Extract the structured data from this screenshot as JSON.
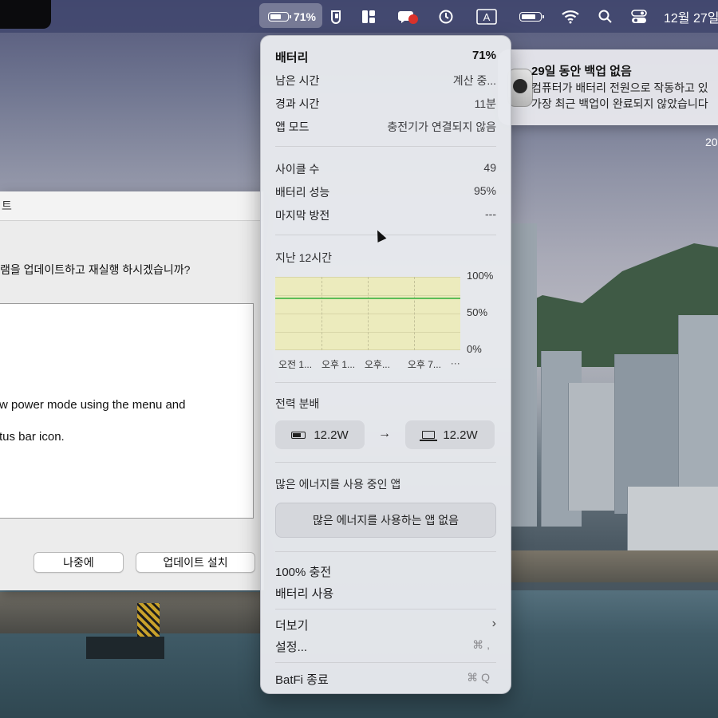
{
  "menubar": {
    "battery_percent": "71%",
    "battery_level": 0.71,
    "clock": "12월 27일"
  },
  "notification": {
    "title": "29일 동안 백업 없음",
    "line1": "컴퓨터가 배터리 전원으로 작동하고 있",
    "line2": "가장 최근 백업이 완료되지 않았습니다"
  },
  "desktop_date": "20",
  "dialog": {
    "title": "트",
    "question": "램을 업데이트하고 재실행 하시겠습니까?",
    "note_line1": "w power mode using the menu and",
    "note_line2": "tus bar icon.",
    "later_button": "나중에",
    "install_button": "업데이트 설치"
  },
  "panel": {
    "title": "배터리",
    "percent": "71%",
    "rows": [
      {
        "label": "남은 시간",
        "value": "계산 중..."
      },
      {
        "label": "경과 시간",
        "value": "11분"
      },
      {
        "label": "앱 모드",
        "value": "충전기가 연결되지 않음"
      }
    ],
    "health": [
      {
        "label": "사이클 수",
        "value": "49"
      },
      {
        "label": "배터리 성능",
        "value": "95%"
      },
      {
        "label": "마지막 방전",
        "value": "---"
      }
    ],
    "history_label": "지난 12시간",
    "power_label": "전력 분배",
    "power_in": "12.2W",
    "power_out": "12.2W",
    "arrow": "→",
    "energy_label": "많은 에너지를 사용 중인 앱",
    "energy_none": "많은 에너지를 사용하는 앱 없음",
    "charge_100": "100% 충전",
    "use_battery": "배터리 사용",
    "more": "더보기",
    "more_chevron": "›",
    "settings": "설정...",
    "settings_shortcut": "⌘ ,",
    "quit": "BatFi 종료",
    "quit_shortcut": "⌘ Q"
  },
  "chart_data": {
    "type": "line",
    "title": "지난 12시간",
    "yticks": [
      "100%",
      "50%",
      "0%"
    ],
    "xticks": [
      "오전 1...",
      "오후 1...",
      "오후...",
      "오후 7...",
      "···"
    ],
    "ylim": [
      0,
      100
    ],
    "series": [
      {
        "values": [
          71,
          71,
          71,
          71,
          71
        ],
        "color": "#5cbd58"
      }
    ],
    "grid": true
  }
}
